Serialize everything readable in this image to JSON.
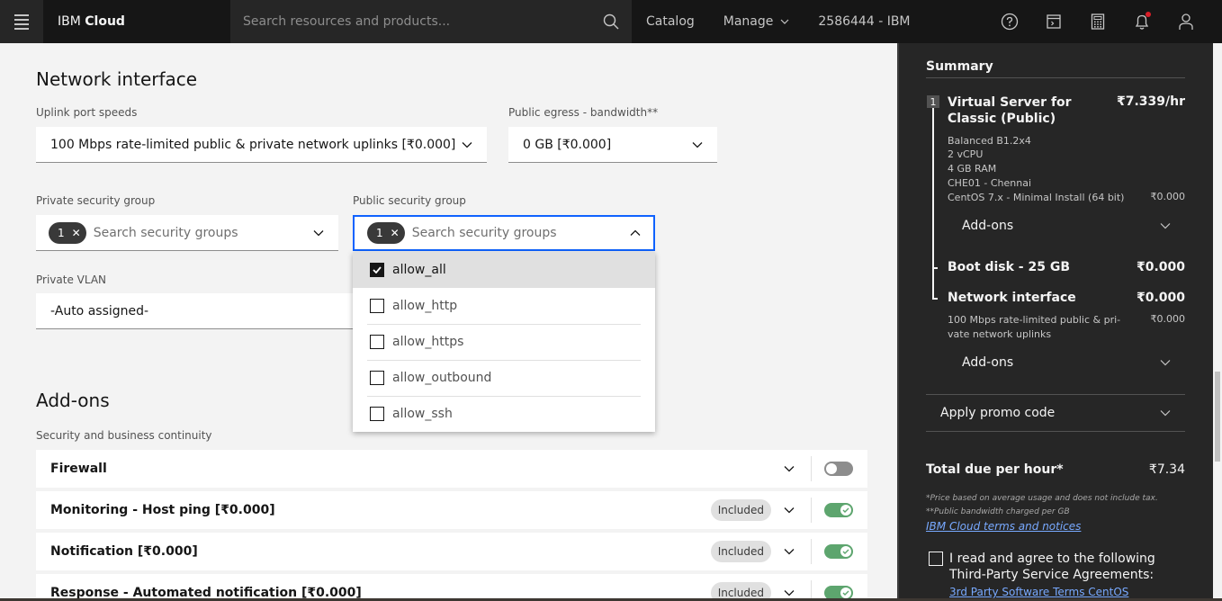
{
  "topbar": {
    "brand_regular": "IBM",
    "brand_bold": "Cloud",
    "search_placeholder": "Search resources and products...",
    "links": {
      "catalog": "Catalog",
      "manage": "Manage"
    },
    "account": "2586444 - IBM",
    "icons": [
      "help-icon",
      "cloud-shell-icon",
      "cost-estimator-icon",
      "notification-icon",
      "user-icon"
    ],
    "notification_dot_color": "#da1e28"
  },
  "network": {
    "title": "Network interface",
    "uplink_label": "Uplink port speeds",
    "uplink_value": "100 Mbps rate-limited public & private network uplinks [₹0.000]",
    "egress_label": "Public egress - bandwidth**",
    "egress_value": "0 GB [₹0.000]",
    "private_sg_label": "Private security group",
    "private_sg_count": "1",
    "private_sg_placeholder": "Search security groups",
    "public_sg_label": "Public security group",
    "public_sg_count": "1",
    "public_sg_placeholder": "Search security groups",
    "vlan_label": "Private VLAN",
    "vlan_value": "-Auto assigned-",
    "dropdown_options": [
      {
        "label": "allow_all",
        "checked": true
      },
      {
        "label": "allow_http",
        "checked": false
      },
      {
        "label": "allow_https",
        "checked": false
      },
      {
        "label": "allow_outbound",
        "checked": false
      },
      {
        "label": "allow_ssh",
        "checked": false
      }
    ]
  },
  "addons": {
    "title": "Add-ons",
    "subtitle": "Security and business continuity",
    "rows": [
      {
        "name": "Firewall",
        "badge": "",
        "enabled": false
      },
      {
        "name": "Monitoring - Host ping [₹0.000]",
        "badge": "Included",
        "enabled": true
      },
      {
        "name": "Notification [₹0.000]",
        "badge": "Included",
        "enabled": true
      },
      {
        "name": "Response - Automated notification [₹0.000]",
        "badge": "Included",
        "enabled": true
      }
    ],
    "toggle_on_color": "#5da56e"
  },
  "summary": {
    "title": "Summary",
    "item_number": "1",
    "item_title": "Virtual Server for Classic (Public)",
    "item_price": "₹7.339/hr",
    "details": [
      "Balanced B1.2x4",
      "2 vCPU",
      "4 GB RAM",
      "CHE01 - Chennai"
    ],
    "os": "CentOS 7.x - Minimal Install (64 bit)",
    "os_price": "₹0.000",
    "addons_label": "Add-ons",
    "boot_disk": "Boot disk - 25 GB",
    "boot_disk_price": "₹0.000",
    "network_interface": "Network interface",
    "network_interface_price": "₹0.000",
    "network_detail": "100 Mbps rate-limited public & pri-vate network uplinks",
    "network_detail_price": "₹0.000",
    "addons_label_2": "Add-ons",
    "promo": "Apply promo code",
    "total_label": "Total due per hour*",
    "total_value": "₹7.34",
    "fine1": "*Price based on average usage and does not include tax.",
    "fine2": "**Public bandwidth charged per GB",
    "terms_link": "IBM Cloud terms and notices",
    "agree_text": "I read and agree to the following Third-Party Service Agreements:",
    "third_party_link": "3rd Party Software Terms CentOS"
  }
}
